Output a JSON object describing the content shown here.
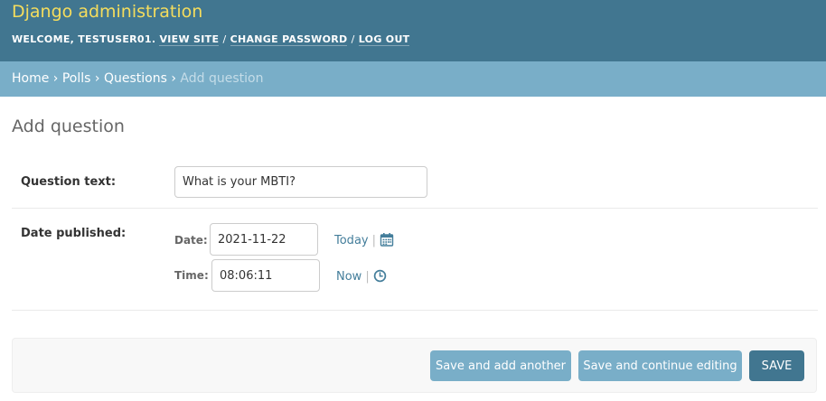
{
  "header": {
    "site_name": "Django administration",
    "welcome_prefix": "Welcome, ",
    "username": "testuser01",
    "welcome_suffix": ".",
    "links": [
      "View site",
      "Change password",
      "Log out"
    ],
    "separator": "/"
  },
  "breadcrumbs": {
    "items": [
      "Home",
      "Polls",
      "Questions"
    ],
    "current": "Add question",
    "arrow": "›"
  },
  "page": {
    "title": "Add question"
  },
  "form": {
    "question_text": {
      "label": "Question text:",
      "value": "What is your MBTI?"
    },
    "date_published": {
      "label": "Date published:",
      "date": {
        "label": "Date:",
        "value": "2021-11-22",
        "shortcut": "Today",
        "icon": "calendar-icon"
      },
      "time": {
        "label": "Time:",
        "value": "08:06:11",
        "shortcut": "Now",
        "icon": "clock-icon"
      },
      "pipe": "|"
    }
  },
  "submit": {
    "save_add_another": "Save and add another",
    "save_continue": "Save and continue editing",
    "save": "Save"
  },
  "colors": {
    "header_bg": "#417690",
    "site_name": "#f5dd5d",
    "breadcrumb_bg": "#79aec8",
    "link": "#447e9b",
    "button_light": "#79aec8",
    "button_dark": "#417690"
  }
}
